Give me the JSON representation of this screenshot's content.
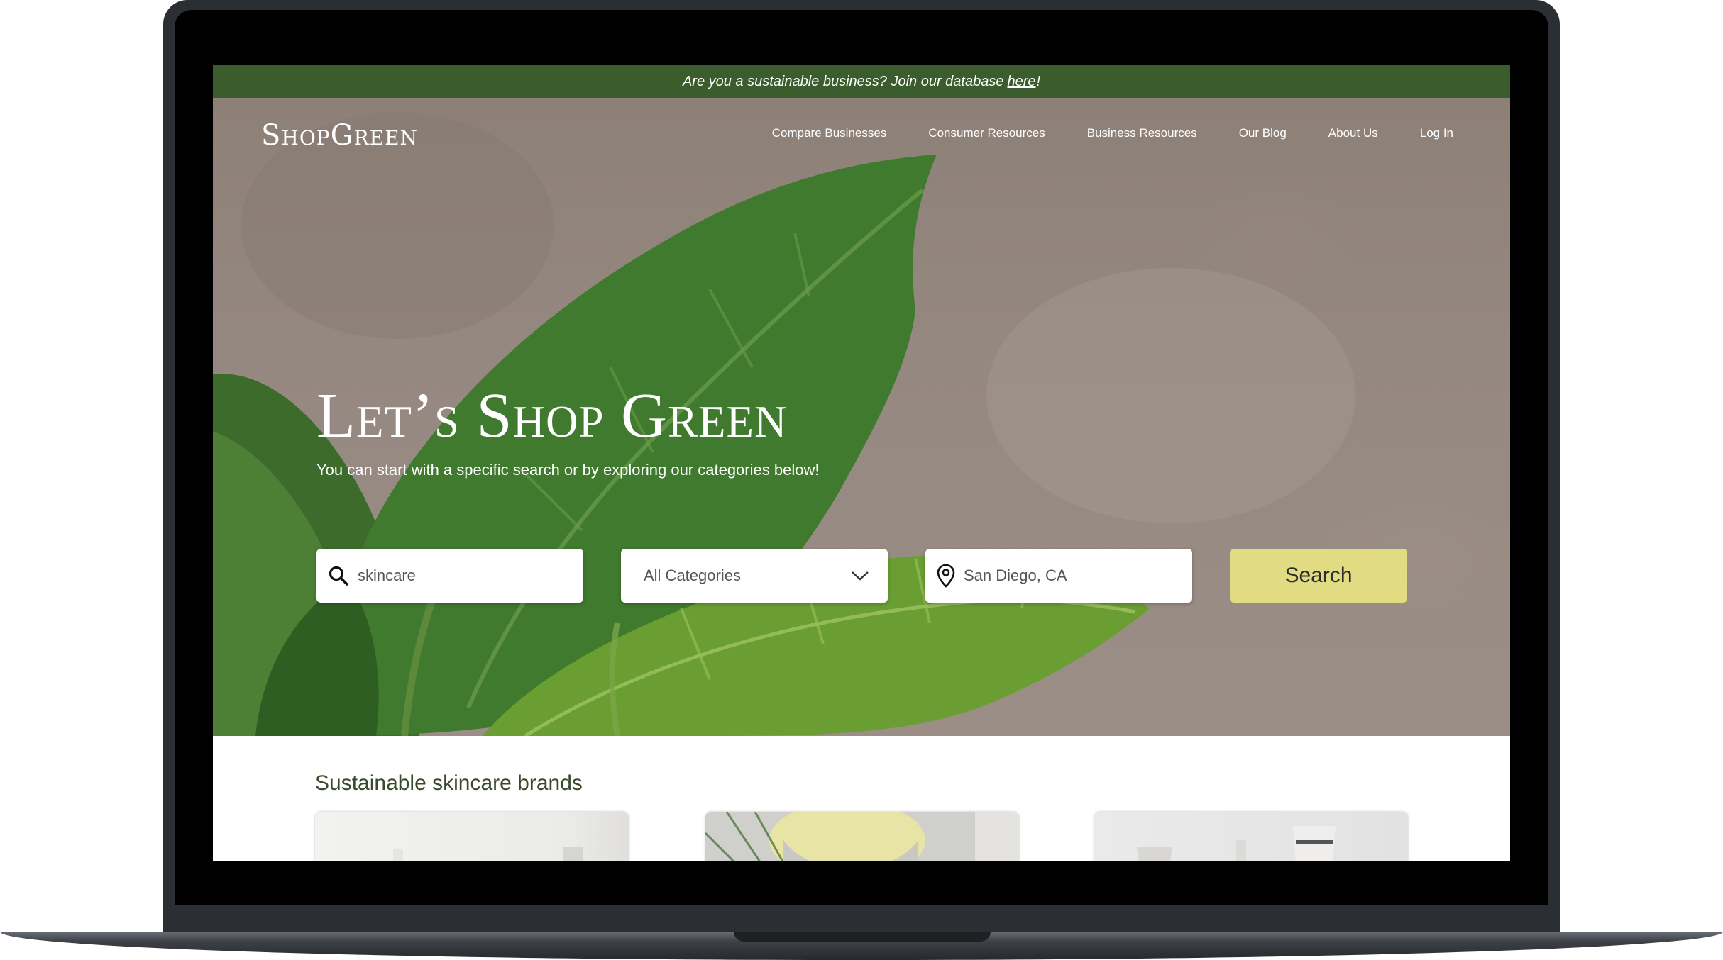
{
  "banner": {
    "text_before": "Are you a sustainable business? Join our database",
    "link": "here",
    "text_after": "!"
  },
  "header": {
    "logo": "ShopGreen",
    "nav": [
      {
        "label": "Compare Businesses"
      },
      {
        "label": "Consumer Resources"
      },
      {
        "label": "Business Resources"
      },
      {
        "label": "Our Blog"
      },
      {
        "label": "About Us"
      },
      {
        "label": "Log In"
      }
    ]
  },
  "hero": {
    "title": "Let’s Shop Green",
    "subtitle": "You can start with a specific search or by exploring our categories below!"
  },
  "search": {
    "query_value": "skincare",
    "category_value": "All Categories",
    "location_value": "San Diego, CA",
    "button_label": "Search"
  },
  "section": {
    "title": "Sustainable skincare brands"
  },
  "colors": {
    "banner": "#3b5c2c",
    "button": "#e1dc82",
    "section_title": "#3a4a2a"
  },
  "icons": [
    "search-icon",
    "chevron-down-icon",
    "location-pin-icon",
    "leaf-icon"
  ]
}
